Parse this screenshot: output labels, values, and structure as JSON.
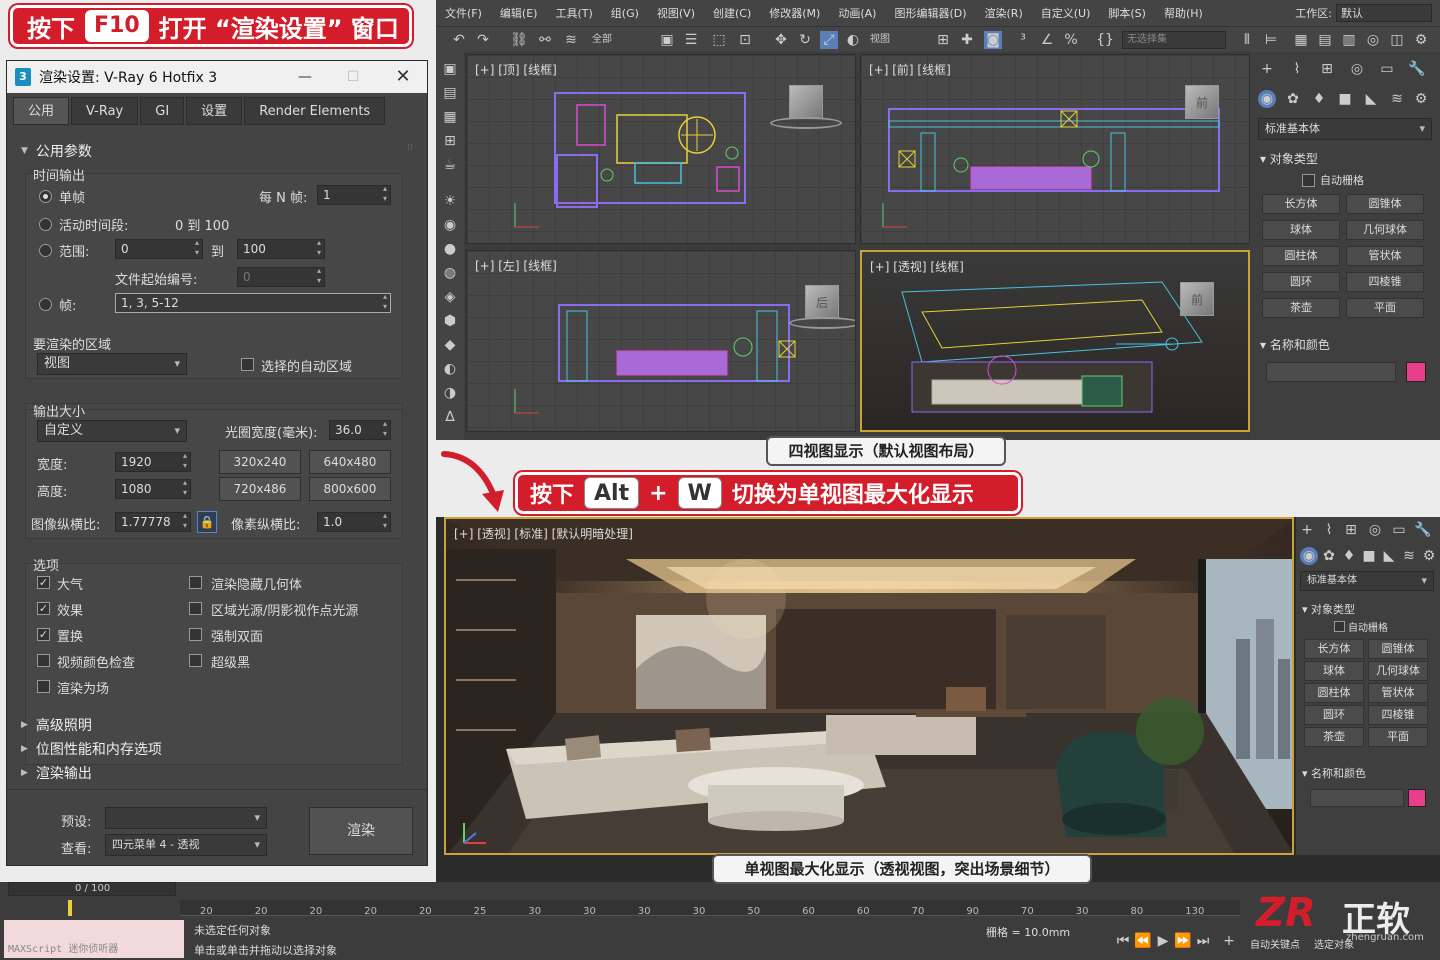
{
  "banner_top": {
    "prefix": "按下",
    "key": "F10",
    "suffix": "打开 “渲染设置” 窗口"
  },
  "dialog": {
    "title": "渲染设置: V-Ray 6 Hotfix 3",
    "app_icon": "3",
    "tabs": [
      "公用",
      "V-Ray",
      "GI",
      "设置",
      "Render Elements"
    ],
    "common_params": {
      "header": "公用参数",
      "time_output": {
        "label": "时间输出",
        "single": "单帧",
        "every_n_label": "每 N 帧:",
        "every_n_value": "1",
        "active_segment": "活动时间段:",
        "active_range": "0 到 100",
        "range_label": "范围:",
        "range_from": "0",
        "to_label": "到",
        "range_to": "100",
        "file_start_label": "文件起始编号:",
        "file_start_value": "0",
        "frames_label": "帧:",
        "frames_value": "1, 3, 5-12"
      },
      "area": {
        "label": "要渲染的区域",
        "value": "视图",
        "auto_region": "选择的自动区域"
      },
      "output_size": {
        "label": "输出大小",
        "preset": "自定义",
        "aperture_label": "光圈宽度(毫米):",
        "aperture_value": "36.0",
        "width_label": "宽度:",
        "width_value": "1920",
        "height_label": "高度:",
        "height_value": "1080",
        "presets": [
          "320x240",
          "640x480",
          "720x486",
          "800x600"
        ],
        "aspect_label": "图像纵横比:",
        "aspect_value": "1.77778",
        "pixel_aspect_label": "像素纵横比:",
        "pixel_aspect_value": "1.0"
      },
      "options": {
        "label": "选项",
        "left": [
          {
            "label": "大气",
            "checked": true
          },
          {
            "label": "效果",
            "checked": true
          },
          {
            "label": "置换",
            "checked": true
          },
          {
            "label": "视频颜色检查",
            "checked": false
          },
          {
            "label": "渲染为场",
            "checked": false
          }
        ],
        "right": [
          {
            "label": "渲染隐藏几何体",
            "checked": false
          },
          {
            "label": "区域光源/阴影视作点光源",
            "checked": false
          },
          {
            "label": "强制双面",
            "checked": false
          },
          {
            "label": "超级黑",
            "checked": false
          }
        ]
      }
    },
    "collapsed_sections": [
      "高级照明",
      "位图性能和内存选项",
      "渲染输出"
    ],
    "preset_label": "预设:",
    "view_label": "查看:",
    "view_value": "四元菜单 4 - 透视",
    "render_button": "渲染"
  },
  "max_ui": {
    "menus": [
      "文件(F)",
      "编辑(E)",
      "工具(T)",
      "组(G)",
      "视图(V)",
      "创建(C)",
      "修改器(M)",
      "动画(A)",
      "图形编辑器(D)",
      "渲染(R)",
      "自定义(U)",
      "脚本(S)",
      "帮助(H)"
    ],
    "workspace_label": "工作区:",
    "workspace_value": "默认",
    "toolbar": {
      "selection_filter": "全部",
      "view_dropdown": "视图",
      "named_sel": "无选择集"
    },
    "viewports": [
      {
        "label": "[+] [顶] [线框]",
        "cube": ""
      },
      {
        "label": "[+] [前] [线框]",
        "cube": "前"
      },
      {
        "label": "[+] [左] [线框]",
        "cube": "后"
      },
      {
        "label": "[+] [透视] [线框]",
        "cube": "前"
      }
    ],
    "cmd_panel": {
      "category": "标准基本体",
      "object_type": "对象类型",
      "autogrid": "自动栅格",
      "buttons": [
        "长方体",
        "圆锥体",
        "球体",
        "几何球体",
        "圆柱体",
        "管状体",
        "圆环",
        "四棱锥",
        "茶壶",
        "平面"
      ],
      "name_color": "名称和颜色",
      "swatch_color": "#e83e8c"
    }
  },
  "caption_quad": "四视图显示（默认视图布局）",
  "mid_banner": {
    "prefix": "按下",
    "key1": "Alt",
    "plus": "+",
    "key2": "W",
    "suffix": "切换为单视图最大化显示"
  },
  "max_viewport_label": "[+] [透视] [标准] [默认明暗处理]",
  "caption_single": "单视图最大化显示（透视视图，突出场景细节）",
  "timeline": {
    "frame_counter": "0 / 100",
    "ticks": [
      "20",
      "20",
      "20",
      "20",
      "20",
      "25",
      "30",
      "30",
      "30",
      "30",
      "50",
      "60",
      "60",
      "70",
      "90",
      "70",
      "30",
      "80",
      "130"
    ],
    "maxscript": "MAXScript 迷你侦听器",
    "status1": "未选定任何对象",
    "status2": "单击或单击并拖动以选择对象",
    "grid": "栅格 = 10.0mm",
    "auto_key": "自动关键点",
    "set_key": "选定对象"
  },
  "watermark": {
    "logo": "ZR",
    "name": "正软",
    "url": "zhengruan.com"
  },
  "colors": {
    "brand_red": "#d31d2b",
    "accent_gold": "#c9a23a",
    "swatch": "#e83e8c"
  }
}
